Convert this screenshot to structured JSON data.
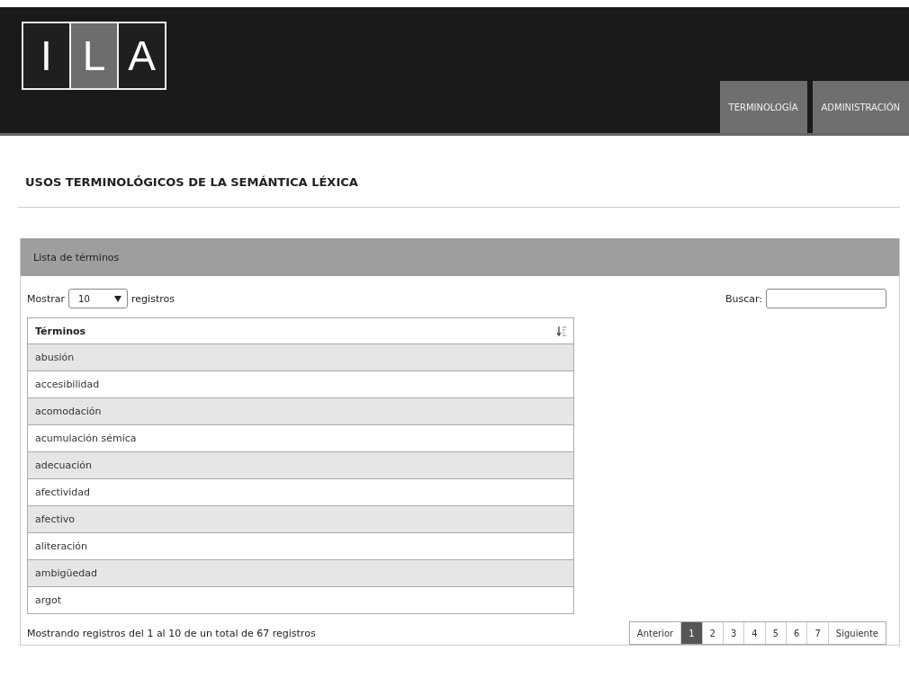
{
  "logo": {
    "letters": [
      {
        "text": "I",
        "selected": false
      },
      {
        "text": "L",
        "selected": true
      },
      {
        "text": "A",
        "selected": false
      }
    ]
  },
  "nav": [
    {
      "label": "TERMINOLOGÍA"
    },
    {
      "label": "ADMINISTRACIÓN"
    }
  ],
  "page_title": "USOS TERMINOLÓGICOS DE LA SEMÁNTICA LÉXICA",
  "panel": {
    "title": "Lista de términos",
    "length_label_before": "Mostrar",
    "length_value": "10",
    "length_label_after": "registros",
    "search_label": "Buscar:",
    "table": {
      "columns": [
        "Términos"
      ],
      "rows": [
        "abusión",
        "accesibilidad",
        "acomodación",
        "acumulación sémica",
        "adecuación",
        "afectividad",
        "afectivo",
        "aliteración",
        "ambigüedad",
        "argot"
      ]
    },
    "info": "Mostrando registros del 1 al 10 de un total de 67 registros",
    "pagination": {
      "previous": "Anterior",
      "next": "Siguiente",
      "pages": [
        {
          "label": "1",
          "selected": true
        },
        {
          "label": "2",
          "selected": false
        },
        {
          "label": "3",
          "selected": false
        },
        {
          "label": "4",
          "selected": false
        },
        {
          "label": "5",
          "selected": false
        },
        {
          "label": "6",
          "selected": false
        },
        {
          "label": "7",
          "selected": false
        }
      ]
    }
  }
}
